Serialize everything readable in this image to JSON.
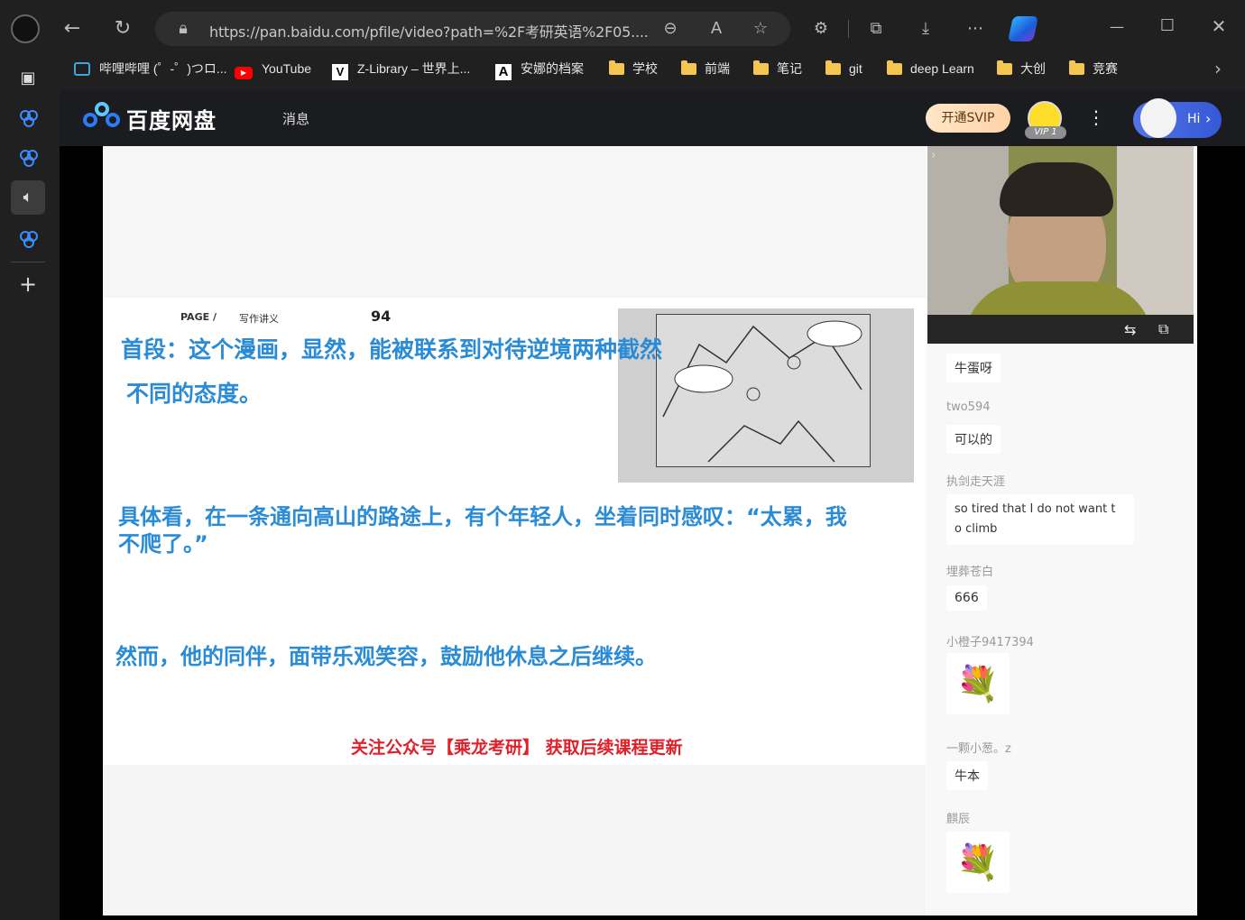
{
  "browser": {
    "url": "https://pan.baidu.com/pfile/video?path=%2F考研英语%2F05....",
    "bookmarks": [
      {
        "label": "哔哩哔哩 (゜-゜)つロ..."
      },
      {
        "label": "YouTube"
      },
      {
        "label": "Z-Library – 世界上..."
      },
      {
        "label": "安娜的档案"
      },
      {
        "label": "学校"
      },
      {
        "label": "前端"
      },
      {
        "label": "笔记"
      },
      {
        "label": "git"
      },
      {
        "label": "deep Learn"
      },
      {
        "label": "大创"
      },
      {
        "label": "竞赛"
      }
    ]
  },
  "header": {
    "logo": "百度网盘",
    "message": "消息",
    "svip": "开通SVIP",
    "vip_level": "VIP 1",
    "hi": "Hi"
  },
  "slide": {
    "page_label": "PAGE /",
    "section": "写作讲义",
    "page_number": "94",
    "para1_line1": "首段：这个漫画，显然，能被联系到对待逆境两种截然",
    "para1_line2": "不同的态度。",
    "para2_line1": "具体看，在一条通向高山的路途上，有个年轻人，坐着同时感叹：“太累，我",
    "para2_line2": "不爬了。”",
    "para3": "然而，他的同伴，面带乐观笑容，鼓励他休息之后继续。",
    "footer": "关注公众号【乘龙考研】 获取后续课程更新"
  },
  "chat": [
    {
      "user": "",
      "text": "牛蛋呀"
    },
    {
      "user": "two594",
      "text": "可以的"
    },
    {
      "user": "执剑走天涯",
      "text": "so tired that I do not want t o climb"
    },
    {
      "user": "埋葬苍白",
      "text": "666"
    },
    {
      "user": "小橙子9417394",
      "gift": "rose-bouquet"
    },
    {
      "user": "一颗小葱。z",
      "text": "牛本"
    },
    {
      "user": "麒辰",
      "gift": "rose-bouquet"
    }
  ]
}
